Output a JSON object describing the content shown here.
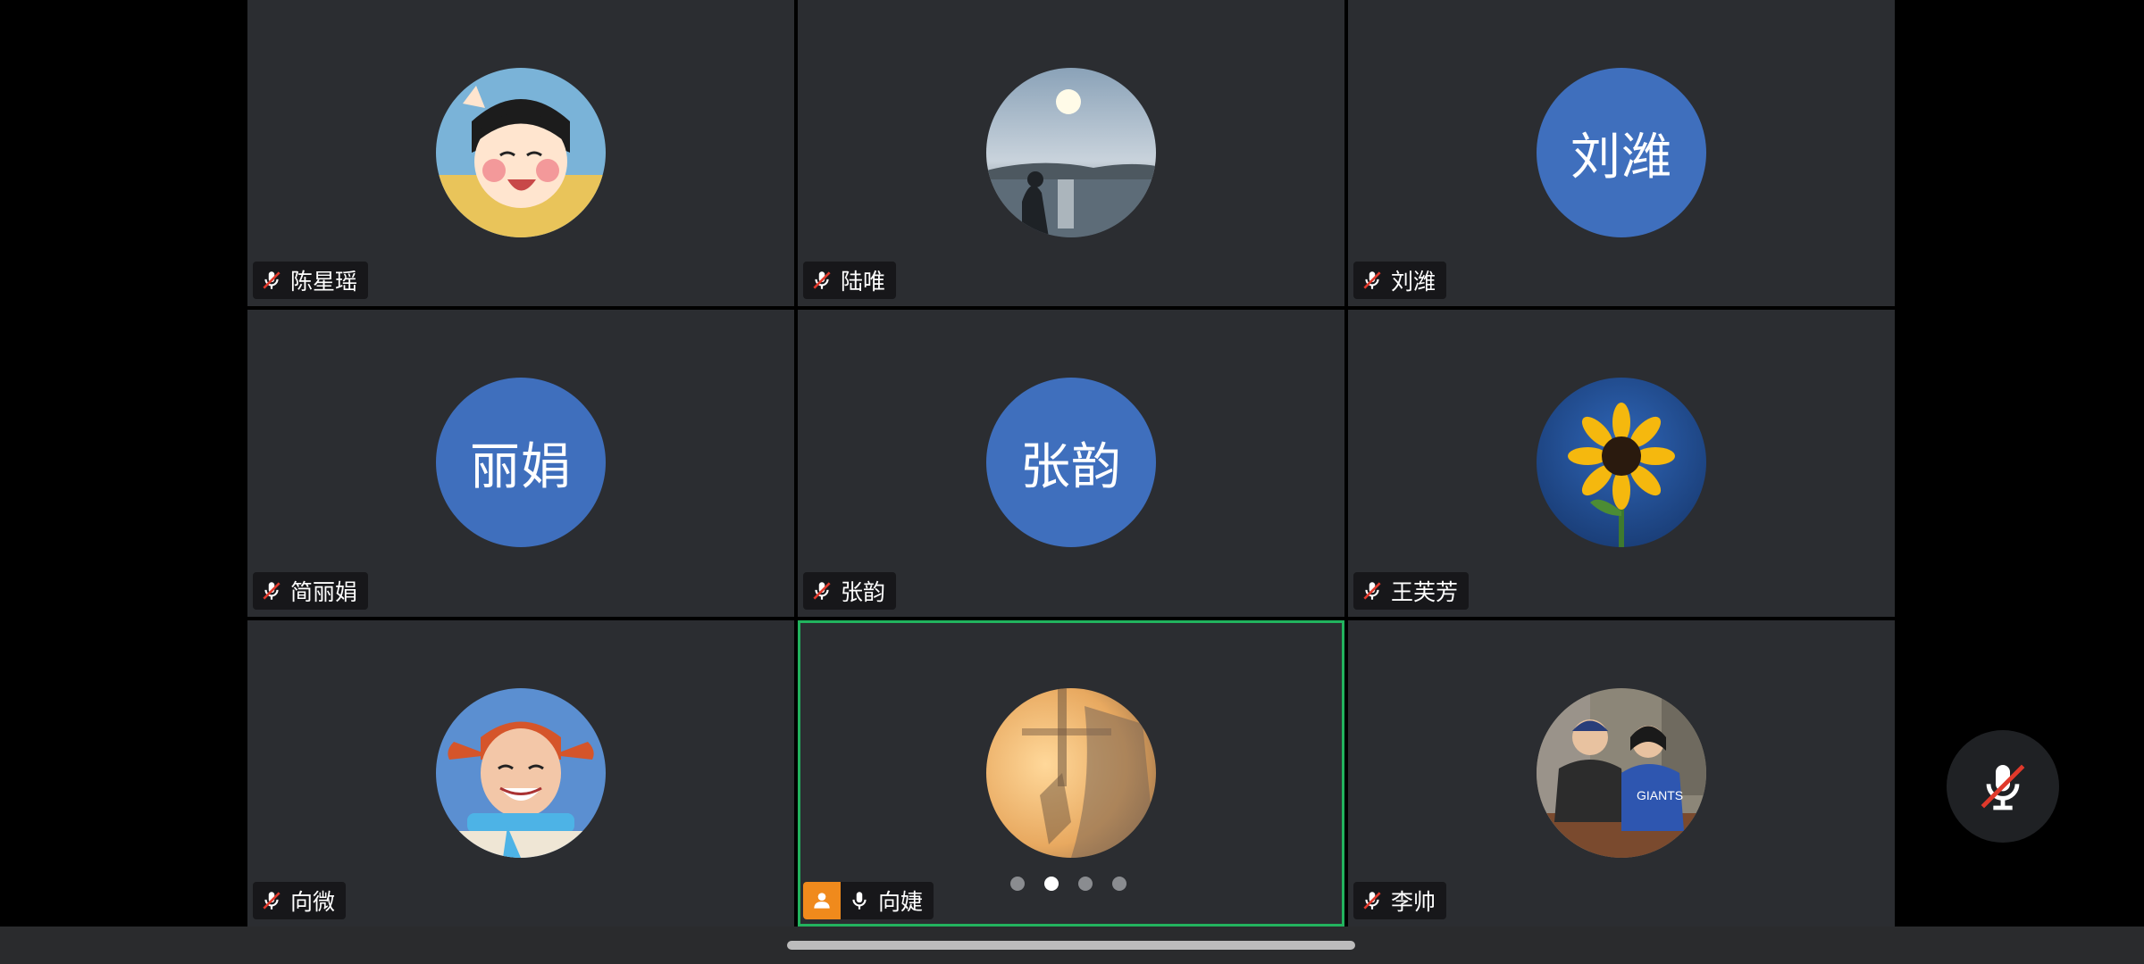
{
  "app": {
    "name": "video-meeting-gallery"
  },
  "colors": {
    "tile_bg": "#2b2d31",
    "initials_bg": "#3f6fbd",
    "active_border": "#22b35e",
    "host_badge": "#f08a1c",
    "muted_slash": "#e0392b"
  },
  "participants": [
    {
      "name": "陈星瑶",
      "avatar": "cartoon-girl-avatar",
      "muted": true
    },
    {
      "name": "陆唯",
      "avatar": "sunset-lake-avatar",
      "muted": true
    },
    {
      "name": "刘潍",
      "initials": "刘潍",
      "muted": true
    },
    {
      "name": "简丽娟",
      "initials": "丽娟",
      "muted": true
    },
    {
      "name": "张韵",
      "initials": "张韵",
      "muted": true
    },
    {
      "name": "王芙芳",
      "avatar": "sunflower-avatar",
      "muted": true
    },
    {
      "name": "向微",
      "avatar": "red-braids-girl-avatar",
      "muted": true
    },
    {
      "name": "向婕",
      "avatar": "sunlight-shadow-avatar",
      "muted": false,
      "host": true,
      "speaking": true
    },
    {
      "name": "李帅",
      "avatar": "two-friends-photo-avatar",
      "muted": true
    }
  ],
  "pagination": {
    "total": 4,
    "current": 2
  },
  "controls": {
    "mute_icon": "mic-off-icon"
  }
}
